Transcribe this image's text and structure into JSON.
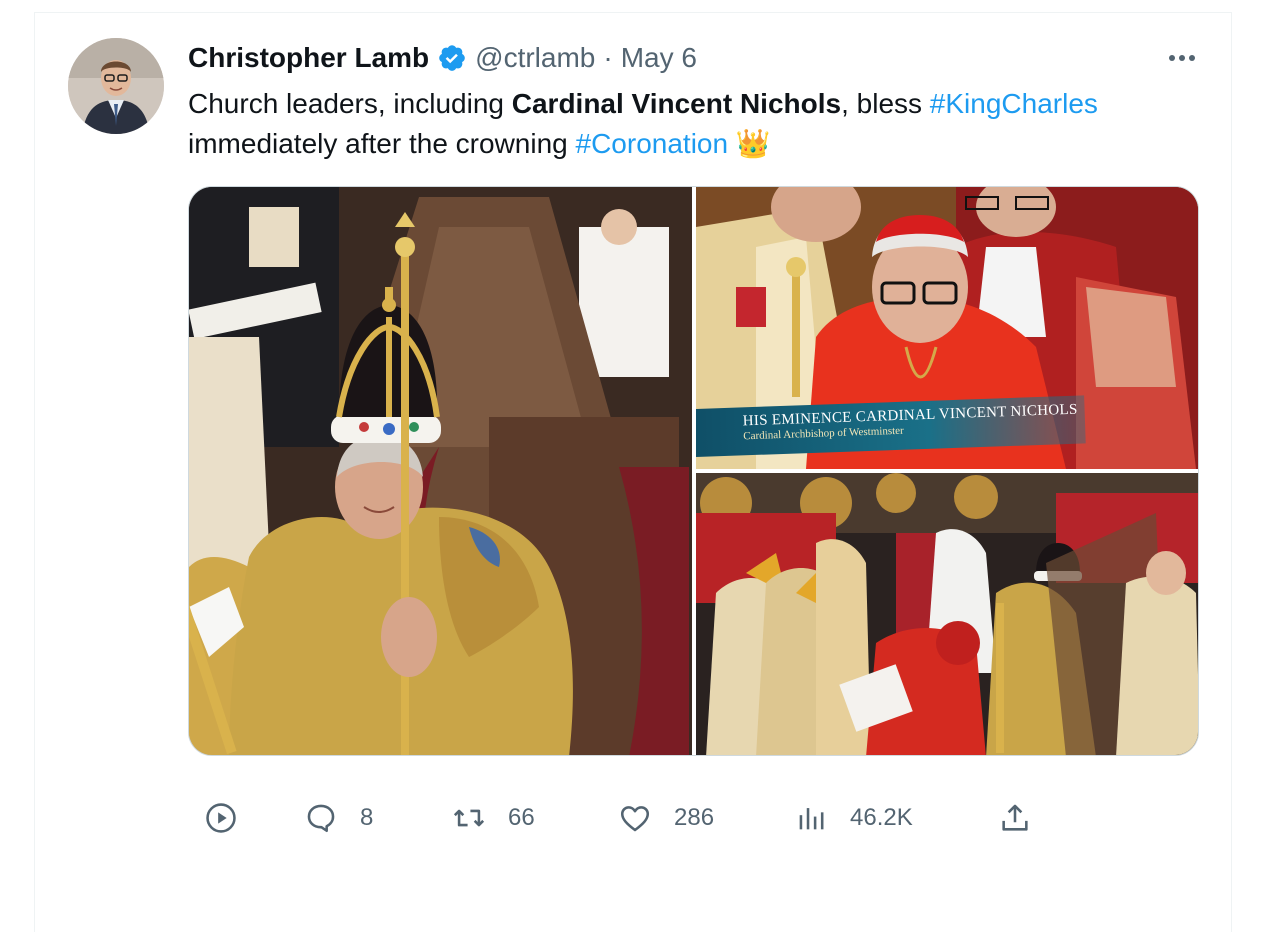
{
  "tweet": {
    "author_name": "Christopher Lamb",
    "handle": "@ctrlamb",
    "separator": "·",
    "date": "May 6",
    "text_parts": {
      "t1": "Church leaders, including ",
      "t2": "Cardinal Vincent Nichols",
      "t3": ", bless ",
      "t4": "#KingCharles",
      "t5": " immediately after the crowning ",
      "t6": "#Coronation",
      "t7": "👑"
    },
    "media_caption": {
      "title": "HIS EMINENCE CARDINAL VINCENT NICHOLS",
      "subtitle": "Cardinal Archbishop of Westminster"
    },
    "actions": {
      "replies": "8",
      "retweets": "66",
      "likes": "286",
      "views": "46.2K"
    }
  },
  "icons": {
    "verified": "verified-badge-icon",
    "more": "more-icon",
    "play": "play-icon",
    "reply": "reply-icon",
    "retweet": "retweet-icon",
    "like": "heart-icon",
    "views": "views-icon",
    "share": "share-icon"
  },
  "colors": {
    "accent": "#1d9bf0",
    "secondary_text": "#536471",
    "primary_text": "#0f1419",
    "border": "#cfd9de"
  }
}
